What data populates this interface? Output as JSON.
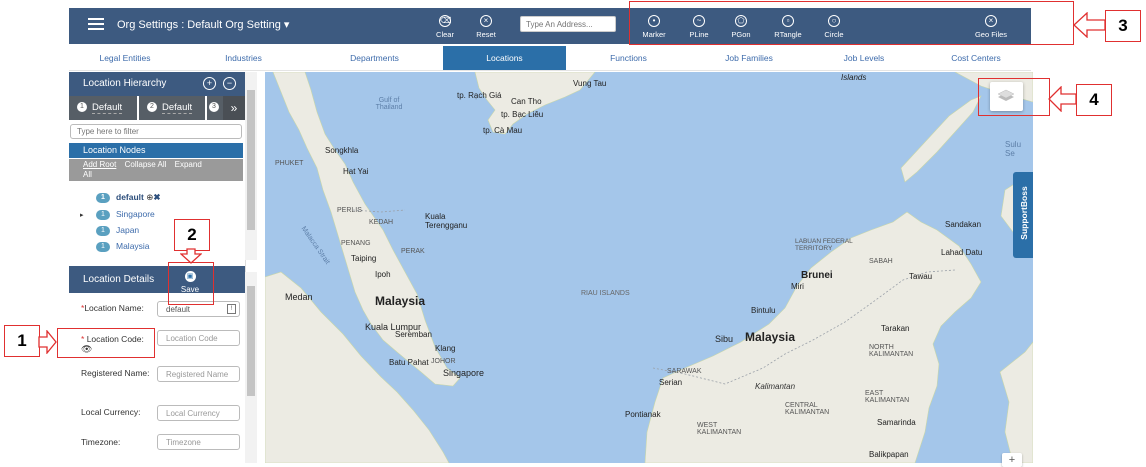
{
  "topbar": {
    "title": "Org Settings : Default Org Setting",
    "title_caret": "▾",
    "clear_label": "Clear",
    "reset_label": "Reset",
    "address_placeholder": "Type An Address...",
    "tools": [
      "Marker",
      "PLine",
      "PGon",
      "RTangle",
      "Circle"
    ],
    "geofiles_label": "Geo Files"
  },
  "tabs": [
    "Legal Entities",
    "Industries",
    "Departments",
    "Locations",
    "Functions",
    "Job Families",
    "Job Levels",
    "Cost Centers"
  ],
  "active_tab": "Locations",
  "hierarchy": {
    "title": "Location Hierarchy",
    "tabs": [
      {
        "num": "1",
        "label": "Default"
      },
      {
        "num": "2",
        "label": "Default"
      },
      {
        "num": "3",
        "label": ""
      }
    ],
    "more": "»",
    "filter_placeholder": "Type here to filter",
    "nodes_title": "Location Nodes",
    "actions": [
      "Add Root",
      "Collapse All",
      "Expand"
    ],
    "actions_wrap": "All",
    "nodes": [
      {
        "count": "1",
        "name": "default"
      },
      {
        "count": "1",
        "name": "Singapore"
      },
      {
        "count": "1",
        "name": "Japan"
      },
      {
        "count": "1",
        "name": "Malaysia"
      }
    ]
  },
  "details": {
    "title": "Location Details",
    "save_label": "Save",
    "fields": {
      "name_label": "Location Name:",
      "name_value": "default",
      "code_label": "Location Code:",
      "code_placeholder": "Location Code",
      "regname_label": "Registered Name:",
      "regname_placeholder": "Registered Name",
      "currency_label": "Local Currency:",
      "currency_placeholder": "Local Currency",
      "timezone_label": "Timezone:",
      "timezone_placeholder": "Timezone"
    },
    "required_mark": "*"
  },
  "map": {
    "labels": {
      "gulf": "Gulf of Thailand",
      "vungtau": "Vung Tau",
      "rachgia": "tp. Rạch Giá",
      "cantho": "Can Tho",
      "baclieu": "tp. Bạc Liêu",
      "camau": "tp. Cà Mau",
      "phuket": "PHUKET",
      "songkhla": "Songkhla",
      "hatyai": "Hat Yai",
      "perlis": "PERLIS",
      "kedah": "KEDAH",
      "penang": "PENANG",
      "taiping": "Taiping",
      "ipoh": "Ipoh",
      "kualaterengganu": "Kuala Terengganu",
      "perak": "PERAK",
      "malacca_strait": "Malacca Strait",
      "medan": "Medan",
      "malaysia_w": "Malaysia",
      "kuala_lumpur": "Kuala Lumpur",
      "seremban": "Seremban",
      "klang": "Klang",
      "batu_pahat": "Batu Pahat",
      "johor": "JOHOR",
      "singapore": "Singapore",
      "riau": "RIAU ISLANDS",
      "malaysia_e": "Malaysia",
      "brunei": "Brunei",
      "miri": "Miri",
      "bintulu": "Bintulu",
      "sibu": "Sibu",
      "sarawak": "SARAWAK",
      "kalimantan": "Kalimantan",
      "serian": "Serian",
      "pontianak": "Pontianak",
      "west_kalimantan": "WEST KALIMANTAN",
      "central_kalimantan": "CENTRAL KALIMANTAN",
      "east_kalimantan": "EAST KALIMANTAN",
      "sabah": "SABAH",
      "labuan": "LABUAN FEDERAL TERRITORY",
      "sandakan": "Sandakan",
      "lahad_datu": "Lahad Datu",
      "tawau": "Tawau",
      "tarakan": "Tarakan",
      "north_kalimantan": "NORTH KALIMANTAN",
      "samarinda": "Samarinda",
      "balikpapan": "Balikpapan",
      "islands": "Islands",
      "sulu": "Sulu Se"
    }
  },
  "supportboss_label": "SupportBoss",
  "zoom_in": "+",
  "callouts": [
    "1",
    "2",
    "3",
    "4"
  ]
}
